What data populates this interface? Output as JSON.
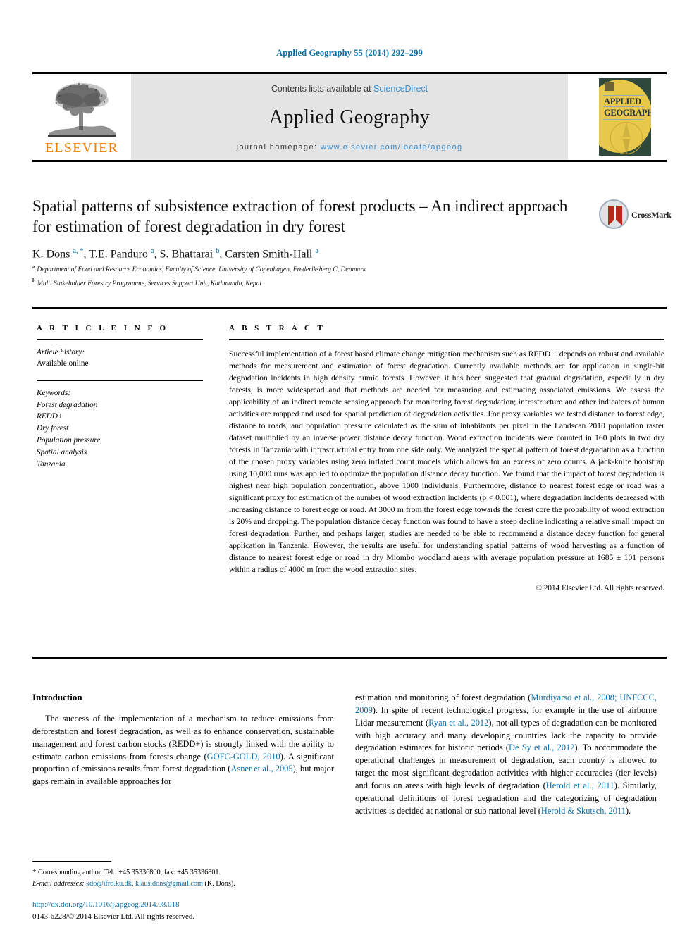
{
  "running_head": "Applied Geography 55 (2014) 292–299",
  "masthead": {
    "contents_prefix": "Contents lists available at ",
    "sciencedirect": "ScienceDirect",
    "journal_title": "Applied Geography",
    "homepage_prefix": "journal homepage: ",
    "homepage_url": "www.elsevier.com/locate/apgeog",
    "publisher_wordmark": "ELSEVIER",
    "cover_word_1": "APPLIED",
    "cover_word_2": "GEOGRAPHY"
  },
  "article": {
    "title": "Spatial patterns of subsistence extraction of forest products – An indirect approach for estimation of forest degradation in dry forest",
    "crossmark_label": "CrossMark",
    "authors_html": "K. Dons <sup class=\"aff-mark\">a, *</sup>, T.E. Panduro <sup class=\"aff-mark\">a</sup>, S. Bhattarai <sup class=\"aff-mark\">b</sup>, Carsten Smith-Hall <sup class=\"aff-mark\">a</sup>",
    "affiliation_a": "Department of Food and Resource Economics, Faculty of Science, University of Copenhagen, Frederiksberg C, Denmark",
    "affiliation_b": "Multi Stakeholder Forestry Programme, Services Support Unit, Kathmandu, Nepal",
    "affiliation_a_mark": "a",
    "affiliation_b_mark": "b"
  },
  "article_info": {
    "heading": "A R T I C L E   I N F O",
    "history_label": "Article history:",
    "history_value": "Available online",
    "keywords_label": "Keywords:",
    "keywords": [
      "Forest degradation",
      "REDD+",
      "Dry forest",
      "Population pressure",
      "Spatial analysis",
      "Tanzania"
    ]
  },
  "abstract": {
    "heading": "A B S T R A C T",
    "text": "Successful implementation of a forest based climate change mitigation mechanism such as REDD + depends on robust and available methods for measurement and estimation of forest degradation. Currently available methods are for application in single-hit degradation incidents in high density humid forests. However, it has been suggested that gradual degradation, especially in dry forests, is more widespread and that methods are needed for measuring and estimating associated emissions. We assess the applicability of an indirect remote sensing approach for monitoring forest degradation; infrastructure and other indicators of human activities are mapped and used for spatial prediction of degradation activities. For proxy variables we tested distance to forest edge, distance to roads, and population pressure calculated as the sum of inhabitants per pixel in the Landscan 2010 population raster dataset multiplied by an inverse power distance decay function. Wood extraction incidents were counted in 160 plots in two dry forests in Tanzania with infrastructural entry from one side only. We analyzed the spatial pattern of forest degradation as a function of the chosen proxy variables using zero inflated count models which allows for an excess of zero counts. A jack-knife bootstrap using 10,000 runs was applied to optimize the population distance decay function. We found that the impact of forest degradation is highest near high population concentration, above 1000 individuals. Furthermore, distance to nearest forest edge or road was a significant proxy for estimation of the number of wood extraction incidents (p < 0.001), where degradation incidents decreased with increasing distance to forest edge or road. At 3000 m from the forest edge towards the forest core the probability of wood extraction is 20% and dropping. The population distance decay function was found to have a steep decline indicating a relative small impact on forest degradation. Further, and perhaps larger, studies are needed to be able to recommend a distance decay function for general application in Tanzania. However, the results are useful for understanding spatial patterns of wood harvesting as a function of distance to nearest forest edge or road in dry Miombo woodland areas with average population pressure at 1685 ± 101 persons within a radius of 4000 m from the wood extraction sites.",
    "copyright": "© 2014 Elsevier Ltd. All rights reserved."
  },
  "introduction": {
    "heading": "Introduction",
    "left_paragraph_html": "The success of the implementation of a mechanism to reduce emissions from deforestation and forest degradation, as well as to enhance conservation, sustainable management and forest carbon stocks (REDD+) is strongly linked with the ability to estimate carbon emissions from forests change (<span class=\"cite\">GOFC-GOLD, 2010</span>). A significant proportion of emissions results from forest degradation (<span class=\"cite\">Asner et al., 2005</span>), but major gaps remain in available approaches for",
    "right_paragraph_html": "estimation and monitoring of forest degradation (<span class=\"cite\">Murdiyarso et al., 2008; UNFCCC, 2009</span>). In spite of recent technological progress, for example in the use of airborne Lidar measurement (<span class=\"cite\">Ryan et al., 2012</span>), not all types of degradation can be monitored with high accuracy and many developing countries lack the capacity to provide degradation estimates for historic periods (<span class=\"cite\">De Sy et al., 2012</span>). To accommodate the operational challenges in measurement of degradation, each country is allowed to target the most significant degradation activities with higher accuracies (tier levels) and focus on areas with high levels of degradation (<span class=\"cite\">Herold et al., 2011</span>). Similarly, operational definitions of forest degradation and the categorizing of degradation activities is decided at national or sub national level (<span class=\"cite\">Herold &amp; Skutsch, 2011</span>)."
  },
  "footnote": {
    "corresponding_html": "<span class=\"star\">*</span> Corresponding author. Tel.: +45 35336800; fax: +45 35336801.",
    "email_html": "<span class=\"em\">E-mail addresses:</span> <span class=\"mailto\">kdo@ifro.ku.dk</span>, <span class=\"mailto\">klaus.dons@gmail.com</span> (K. Dons)."
  },
  "doi_block": {
    "doi_url": "http://dx.doi.org/10.1016/j.apgeog.2014.08.018",
    "issn_line": "0143-6228/© 2014 Elsevier Ltd. All rights reserved."
  },
  "colors": {
    "link_blue": "#0a6ea8",
    "sciencedirect_blue": "#3a8fd0",
    "elsevier_orange": "#f08000",
    "panel_grey": "#e4e4e4",
    "cover_green": "#2f4a3c",
    "cover_yellow": "#e8c84a",
    "crossmark_red": "#b42a18"
  }
}
